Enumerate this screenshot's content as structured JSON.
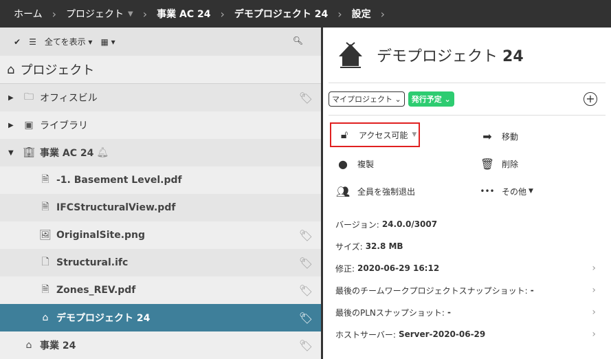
{
  "breadcrumb": {
    "items": [
      "ホーム",
      "プロジェクト",
      "事業 AC 24",
      "デモプロジェクト 24",
      "設定"
    ]
  },
  "toolbar": {
    "filter_label": "全てを表示"
  },
  "tree": {
    "header": "プロジェクト",
    "rows": [
      {
        "label": "オフィスビル",
        "icon": "folder-icon",
        "tag": true
      },
      {
        "label": "ライブラリ",
        "icon": "library-folder-icon",
        "tag": false
      },
      {
        "label": "事業 AC 24",
        "icon": "building-icon",
        "tag": false
      },
      {
        "label": "-1. Basement Level.pdf",
        "icon": "pdf-file-icon",
        "tag": false
      },
      {
        "label": "IFCStructuralView.pdf",
        "icon": "pdf-file-icon",
        "tag": false
      },
      {
        "label": "OriginalSite.png",
        "icon": "image-file-icon",
        "tag": true
      },
      {
        "label": "Structural.ifc",
        "icon": "file-icon",
        "tag": true
      },
      {
        "label": "Zones_REV.pdf",
        "icon": "pdf-file-icon",
        "tag": true
      },
      {
        "label": "デモプロジェクト 24",
        "icon": "project-house-icon",
        "tag": true,
        "selected": true
      },
      {
        "label": "事業 24",
        "icon": "project-house-icon",
        "tag": true
      }
    ]
  },
  "detail": {
    "title_prefix": "デモプロジェクト",
    "title_num": "24",
    "owner_select": "マイプロジェクト",
    "status_pill": "発行予定",
    "actions": {
      "access": "アクセス可能",
      "move": "移動",
      "duplicate": "複製",
      "delete": "削除",
      "kick": "全員を強制退出",
      "more": "その他"
    },
    "info": [
      {
        "label": "バージョン:",
        "value": "24.0.0/3007"
      },
      {
        "label": "サイズ:",
        "value": "32.8 MB"
      },
      {
        "label": "修正:",
        "value": "2020-06-29 16:12"
      },
      {
        "label": "最後のチームワークプロジェクトスナップショット:",
        "value": "-"
      },
      {
        "label": "最後のPLNスナップショット:",
        "value": "-"
      },
      {
        "label": "ホストサーバー:",
        "value": "Server-2020-06-29"
      }
    ]
  },
  "colors": {
    "selected": "#3e7f9a",
    "pill": "#2ecc71",
    "highlight": "#e02020",
    "topbar": "#323232"
  }
}
